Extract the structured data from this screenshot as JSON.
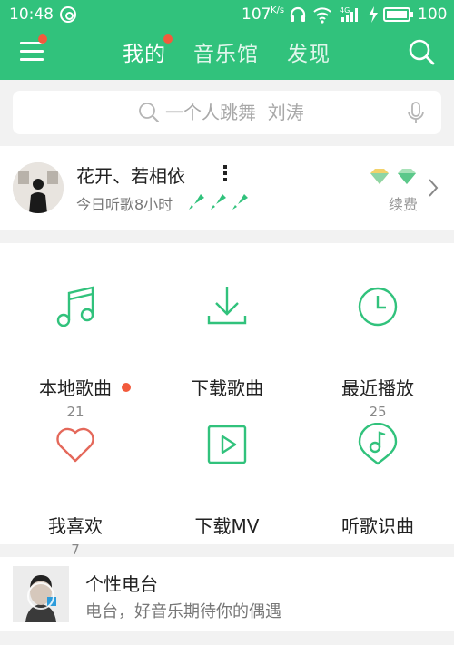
{
  "status_bar": {
    "time": "10:48",
    "network_speed": "107",
    "speed_unit": "K/s",
    "signal_label": "4G",
    "battery": "100"
  },
  "nav": {
    "tabs": [
      {
        "label": "我的",
        "active": true
      },
      {
        "label": "音乐馆",
        "active": false
      },
      {
        "label": "发现",
        "active": false
      }
    ]
  },
  "search": {
    "placeholder": "一个人跳舞  刘涛"
  },
  "profile": {
    "username": "​花开、若相依",
    "listen_time": "今日听歌8小时",
    "renew_label": "续费"
  },
  "grid": [
    {
      "label": "本地歌曲",
      "count": "21",
      "icon": "music-note-icon",
      "dot": true
    },
    {
      "label": "下载歌曲",
      "count": "",
      "icon": "download-icon",
      "dot": false
    },
    {
      "label": "最近播放",
      "count": "25",
      "icon": "clock-icon",
      "dot": false
    },
    {
      "label": "我喜欢",
      "count": "7",
      "icon": "heart-icon",
      "dot": false
    },
    {
      "label": "下载MV",
      "count": "",
      "icon": "mv-play-icon",
      "dot": false
    },
    {
      "label": "听歌识曲",
      "count": "",
      "icon": "music-recognition-icon",
      "dot": false
    }
  ],
  "radio": {
    "title": "个性电台",
    "subtitle": "电台，好音乐期待你的偶遇"
  },
  "colors": {
    "brand_green": "#31c27c",
    "notify_red": "#f25a3c",
    "heart_red": "#e4685a"
  }
}
